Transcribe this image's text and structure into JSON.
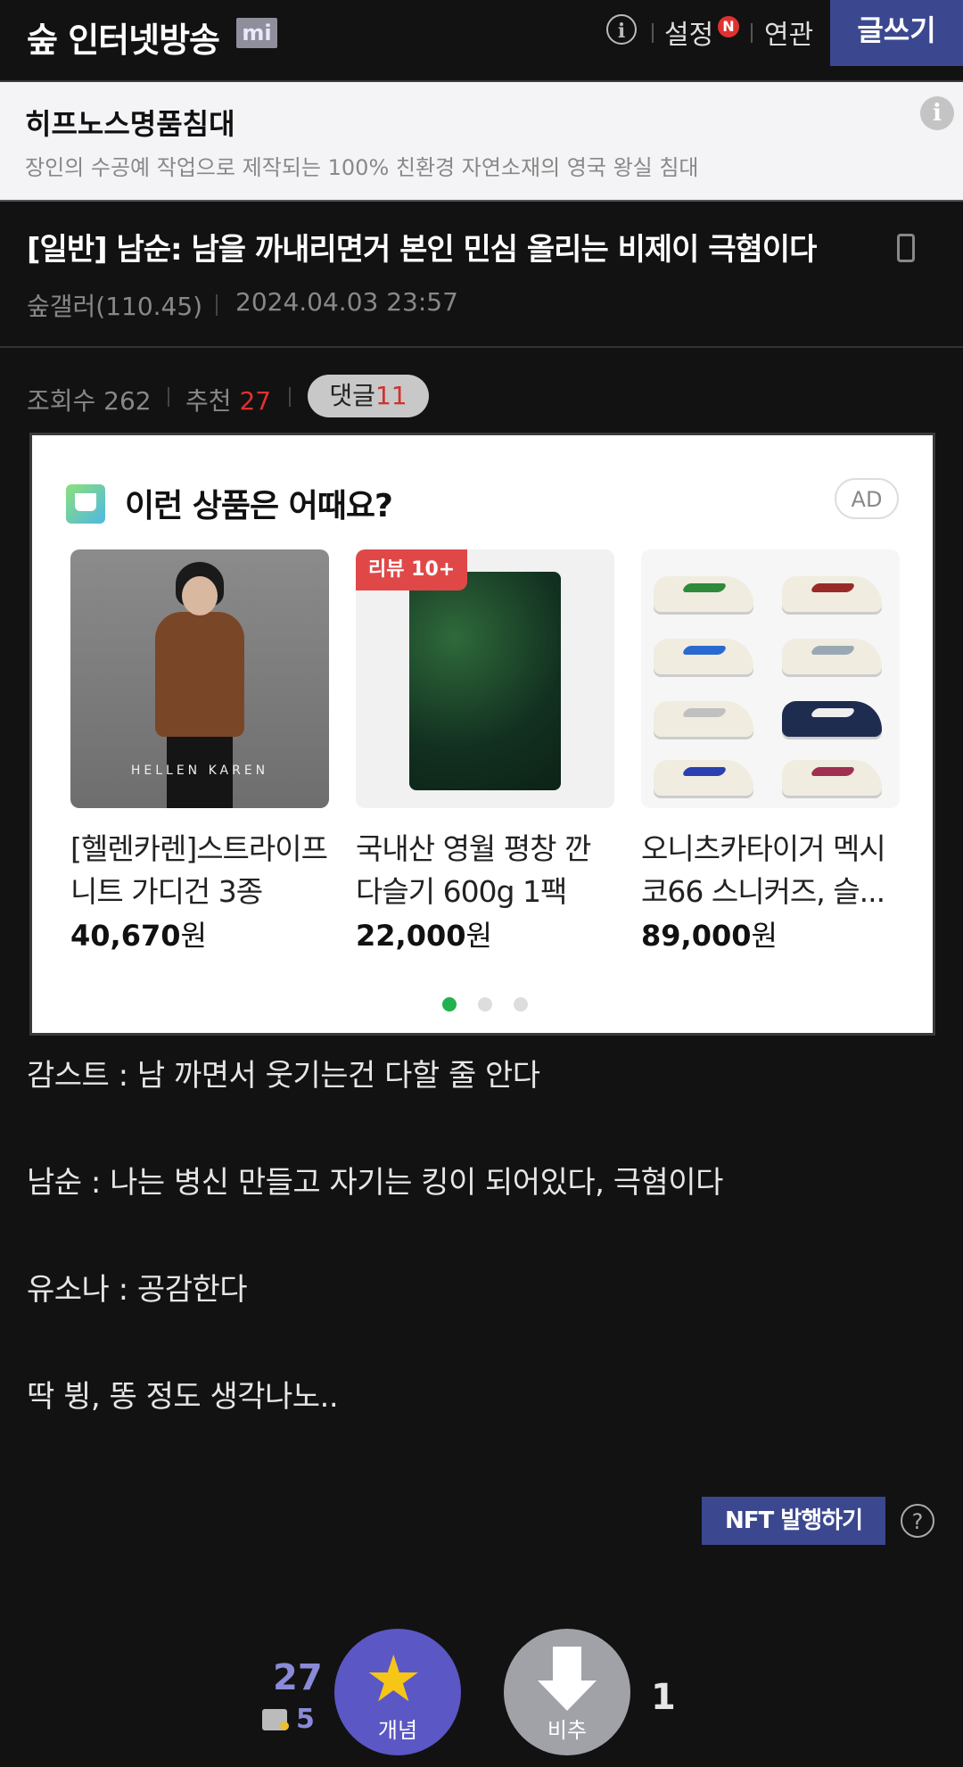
{
  "header": {
    "brand": "숲 인터넷방송",
    "badge": "mi",
    "info_icon": "info-icon",
    "settings_label": "설정",
    "new_badge": "N",
    "related_label": "연관",
    "write_label": "글쓰기"
  },
  "ad_banner": {
    "title": "히프노스명품침대",
    "description": "장인의 수공예 작업으로 제작되는 100% 친환경 자연소재의 영국 왕실 침대",
    "info_icon": "info-icon"
  },
  "post": {
    "title": "[일반] 남순: 남을 까내리면거 본인 민심 올리는 비제이 극혐이다",
    "device_icon": "mobile-icon",
    "author": "숲갤러(110.45)",
    "date": "2024.04.03 23:57",
    "views_label": "조회수 262",
    "rec_label": "추천",
    "rec_count": "27",
    "comments_label": "댓글",
    "comments_count": "11"
  },
  "product_ad": {
    "heading": "이런 상품은 어때요?",
    "ad_label": "AD",
    "products": [
      {
        "name_line1": "[헬렌카렌]스트라이프",
        "name_line2": "니트 가디건 3종",
        "price": "40,670",
        "won": "원",
        "image_text": "HELLEN KAREN"
      },
      {
        "name_line1": "국내산 영월 평창 깐",
        "name_line2": "다슬기 600g 1팩",
        "price": "22,000",
        "won": "원",
        "badge": "리뷰 10+"
      },
      {
        "name_line1": "오니츠카타이거 멕시",
        "name_line2": "코66 스니커즈, 슬...",
        "price": "89,000",
        "won": "원"
      }
    ],
    "pagination": {
      "total": 3,
      "active": 0,
      "active_color": "#22b14c"
    }
  },
  "body": {
    "lines": [
      "감스트 : 남 까면서 웃기는건 다할 줄 안다",
      "남순 : 나는 병신 만들고 자기는 킹이 되어있다, 극혐이다",
      "유소나 : 공감한다",
      "딱 뷩, 똥 정도 생각나노.."
    ]
  },
  "nft": {
    "label": "NFT 발행하기",
    "help": "?"
  },
  "vote": {
    "up_count": "27",
    "fixed_count": "5",
    "up_label": "개념",
    "down_label": "비추",
    "down_count": "1"
  },
  "colors": {
    "accent": "#3b4890",
    "up": "#5b57c4",
    "down": "#a1a1a8",
    "red": "#e03131"
  }
}
